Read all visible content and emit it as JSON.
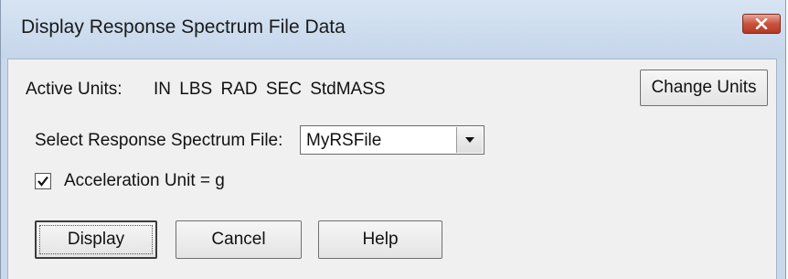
{
  "window": {
    "title": "Display Response Spectrum File Data",
    "close_icon": "close-icon"
  },
  "units": {
    "label": "Active Units:",
    "value": "IN LBS RAD SEC StdMASS",
    "change_button": "Change Units"
  },
  "spectrum": {
    "label": "Select Response Spectrum File:",
    "selected": "MyRSFile",
    "dropdown_icon": "chevron-down-icon"
  },
  "acceleration": {
    "label": "Acceleration Unit = g",
    "checked": true
  },
  "buttons": {
    "display": "Display",
    "cancel": "Cancel",
    "help": "Help"
  },
  "colors": {
    "title_bar": "#c9d8ea",
    "dialog_body": "#f0f0f0",
    "close_button": "#c9523e"
  }
}
